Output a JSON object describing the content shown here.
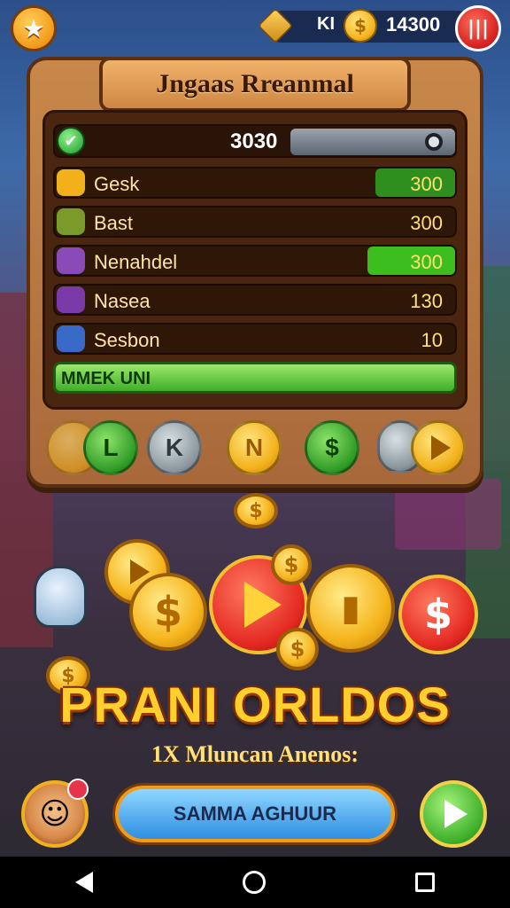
{
  "topbar": {
    "gem_label": "KI",
    "coins": "14300",
    "star_icon": "star-icon",
    "menu_icon": "bars-icon"
  },
  "panel": {
    "title": "Jngaas Rreanmal",
    "score": "3030",
    "rows": [
      {
        "name": "Gesk",
        "value": "300",
        "icon": "coin-icon",
        "bar_fill": 0.2,
        "bar_color": "#2f8f1e"
      },
      {
        "name": "Bast",
        "value": "300",
        "icon": "zombie-icon",
        "bar_fill": 0,
        "bar_color": "#2f8f1e"
      },
      {
        "name": "Nenahdel",
        "value": "300",
        "icon": "monster-icon",
        "bar_fill": 0.22,
        "bar_color": "#3cbf1e"
      },
      {
        "name": "Nasea",
        "value": "130",
        "icon": "sword-icon",
        "bar_fill": 0,
        "bar_color": "#2f8f1e"
      },
      {
        "name": "Sesbon",
        "value": "10",
        "icon": "shield-icon",
        "bar_fill": 0,
        "bar_color": "#2f8f1e"
      }
    ],
    "progress_label": "MMEK UNI"
  },
  "badges": [
    "L",
    "K",
    "N",
    "$",
    "",
    ""
  ],
  "promo": {
    "title": "PRANI ORLDOS",
    "subtitle": "1X Mluncan Anenos:"
  },
  "bottom": {
    "cta_label": "SAMMA AGHUUR"
  }
}
